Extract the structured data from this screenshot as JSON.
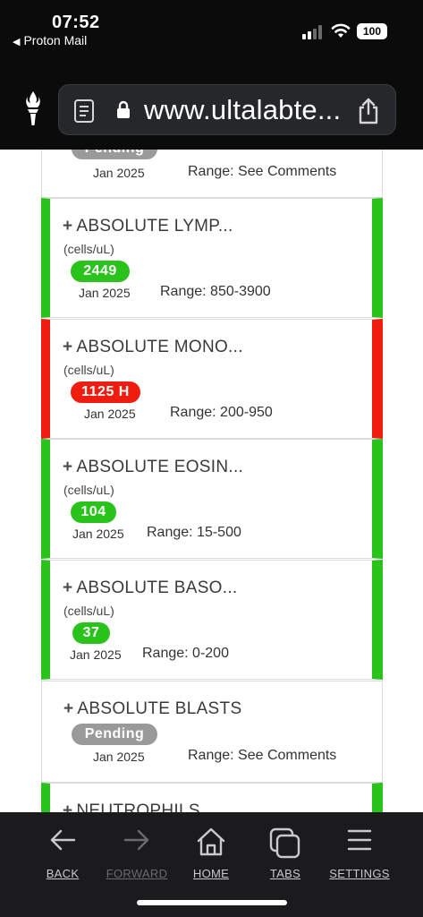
{
  "status_bar": {
    "time": "07:52",
    "back_app": "Proton Mail",
    "battery": "100"
  },
  "browser": {
    "url": "www.ultalabte..."
  },
  "results": [
    {
      "title": "",
      "unit": "",
      "value": "Pending",
      "status": "pending",
      "date": "Jan 2025",
      "range": "Range: See Comments"
    },
    {
      "title": "ABSOLUTE LYMP...",
      "unit": "(cells/uL)",
      "value": "2449",
      "status": "normal",
      "date": "Jan 2025",
      "range": "Range: 850-3900"
    },
    {
      "title": "ABSOLUTE MONO...",
      "unit": "(cells/uL)",
      "value": "1125 H",
      "status": "high",
      "date": "Jan 2025",
      "range": "Range: 200-950"
    },
    {
      "title": "ABSOLUTE EOSIN...",
      "unit": "(cells/uL)",
      "value": "104",
      "status": "normal",
      "date": "Jan 2025",
      "range": "Range: 15-500"
    },
    {
      "title": "ABSOLUTE BASO...",
      "unit": "(cells/uL)",
      "value": "37",
      "status": "normal",
      "date": "Jan 2025",
      "range": "Range: 0-200"
    },
    {
      "title": "ABSOLUTE BLASTS",
      "unit": "",
      "value": "Pending",
      "status": "pending",
      "date": "Jan 2025",
      "range": "Range: See Comments"
    },
    {
      "title": "NEUTROPHILS",
      "unit": "",
      "value": "",
      "status": "normal",
      "date": "",
      "range": ""
    }
  ],
  "toolbar": {
    "back": "BACK",
    "forward": "FORWARD",
    "home": "HOME",
    "tabs": "TABS",
    "settings": "SETTINGS"
  },
  "colors": {
    "normal": "#29c31c",
    "high": "#ee1d10",
    "pending": "#9a9a9a"
  },
  "icons": {
    "signal": "cellular-signal-icon",
    "wifi": "wifi-icon",
    "battery": "battery-icon",
    "site": "torch-logo-icon",
    "reader": "reader-icon",
    "lock": "lock-icon",
    "share": "share-icon",
    "back": "arrow-left-icon",
    "forward": "arrow-right-icon",
    "home": "home-icon",
    "tabs": "tabs-icon",
    "settings": "menu-icon"
  }
}
